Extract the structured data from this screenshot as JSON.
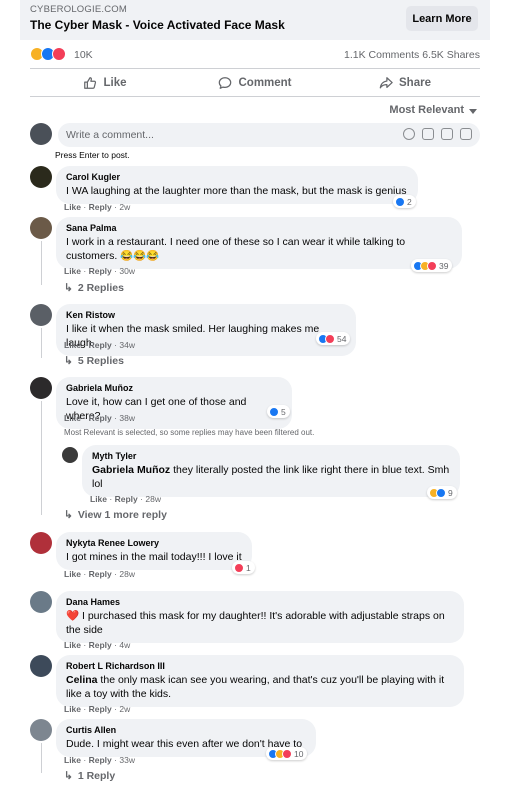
{
  "link": {
    "domain": "CYBEROLOGIE.COM",
    "title": "The Cyber Mask - Voice Activated Face Mask",
    "cta": "Learn More"
  },
  "stats": {
    "reaction_count": "10K",
    "comments": "1.1K Comments",
    "shares": "6.5K Shares"
  },
  "actions": {
    "like": "Like",
    "comment": "Comment",
    "share": "Share"
  },
  "sort_label": "Most Relevant",
  "composer": {
    "placeholder": "Write a comment...",
    "hint": "Press Enter to post."
  },
  "labels": {
    "like": "Like",
    "reply": "Reply",
    "dot": "·"
  },
  "filtered_note": "Most Relevant is selected, so some replies may have been filtered out.",
  "comments": [
    {
      "name": "Carol Kugler",
      "text": "I WA laughing at the laughter more than the mask, but the mask is genius",
      "time": "2w",
      "reactions": [
        "like"
      ],
      "count": "2",
      "replies": "",
      "avatar_color": "#2b2a1c"
    },
    {
      "name": "Sana Palma",
      "text": "I work in a restaurant. I need one of these so I can wear it while talking to customers. 😂😂😂",
      "time": "30w",
      "reactions": [
        "like",
        "haha",
        "love"
      ],
      "count": "39",
      "replies": "2 Replies",
      "avatar_color": "#6b5a48"
    },
    {
      "name": "Ken Ristow",
      "text": "I like it when the mask smiled. Her laughing makes me laugh",
      "time": "34w",
      "reactions": [
        "like",
        "love"
      ],
      "count": "54",
      "replies": "5 Replies",
      "avatar_color": "#5a5f66"
    },
    {
      "name": "Gabriela Muñoz",
      "text": "Love it, how can I get one of those and where?",
      "time": "38w",
      "reactions": [
        "like"
      ],
      "count": "5",
      "replies": "",
      "avatar_color": "#2c2a2b"
    },
    {
      "name": "Nykyta Renee Lowery",
      "text": "I got mines in the mail today!!! I love it",
      "time": "28w",
      "reactions": [
        "love"
      ],
      "count": "1",
      "replies": "",
      "avatar_color": "#b0303a"
    },
    {
      "name": "Dana Hames",
      "text": "❤️ I purchased this mask for my daughter!! It's adorable with adjustable straps on the side",
      "time": "4w",
      "reactions": [],
      "count": "",
      "replies": "",
      "avatar_color": "#6a7a88"
    },
    {
      "name": "Robert L Richardson III",
      "mention": "Celina",
      "text": " the only mask ican see you wearing, and that's cuz you'll be playing with it like a toy with the kids.",
      "time": "2w",
      "reactions": [],
      "count": "",
      "replies": "",
      "avatar_color": "#3d4a5a"
    },
    {
      "name": "Curtis Allen",
      "text": "Dude. I might wear this even after we don't have to",
      "time": "33w",
      "reactions": [
        "like",
        "haha",
        "love"
      ],
      "count": "10",
      "replies": "1 Reply",
      "avatar_color": "#7d8690"
    }
  ],
  "reply": {
    "name": "Myth Tyler",
    "mention": "Gabriela Muñoz",
    "text": " they literally posted the link like right there in blue text. Smh lol",
    "time": "28w",
    "reactions": [
      "haha",
      "like"
    ],
    "count": "9",
    "more": "View 1 more reply",
    "avatar_color": "#3a3a3a"
  },
  "colors": {
    "like": "#1877f2",
    "love": "#f33e58",
    "haha": "#f7b125",
    "bubble": "#f0f2f5"
  }
}
